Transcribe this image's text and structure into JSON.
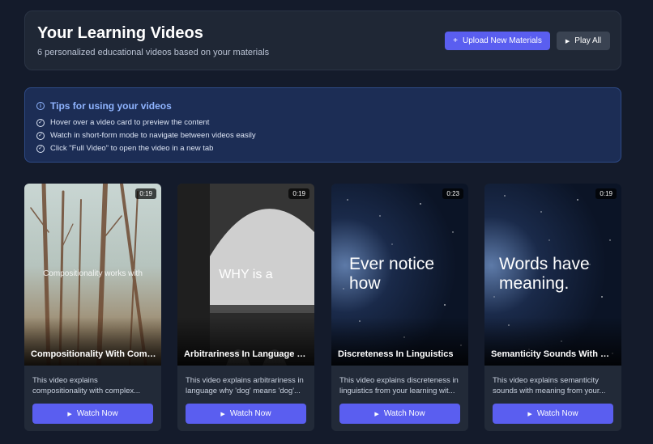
{
  "header": {
    "title": "Your Learning Videos",
    "subtitle": "6 personalized educational videos based on your materials",
    "upload_label": "Upload New Materials",
    "upload_icon": "+",
    "play_all_label": "Play All",
    "play_all_icon": "▶"
  },
  "tips": {
    "title": "Tips for using your videos",
    "items": [
      "Hover over a video card to preview the content",
      "Watch in short-form mode to navigate between videos easily",
      "Click \"Full Video\" to open the video in a new tab"
    ]
  },
  "videos": [
    {
      "title": "Compositionality With Complexity",
      "duration": "0:19",
      "caption": "Compositionality works with",
      "description": "This video explains compositionality with complex...",
      "watch_label": "Watch Now"
    },
    {
      "title": "Arbitrariness In Language Explained",
      "duration": "0:19",
      "caption": "WHY is a",
      "description": "This video explains arbitrariness in language why 'dog' means 'dog'...",
      "watch_label": "Watch Now"
    },
    {
      "title": "Discreteness In Linguistics",
      "duration": "0:23",
      "caption": "Ever notice how",
      "description": "This video explains discreteness in linguistics from your learning wit...",
      "watch_label": "Watch Now"
    },
    {
      "title": "Semanticity Sounds With Meaning",
      "duration": "0:19",
      "caption": "Words have meaning.",
      "description": "This video explains semanticity sounds with meaning from your...",
      "watch_label": "Watch Now"
    }
  ],
  "colors": {
    "background": "#141b2b",
    "accent": "#5a5ef0",
    "tips_bg": "#1c2d55",
    "tips_title": "#8fb4ff"
  }
}
